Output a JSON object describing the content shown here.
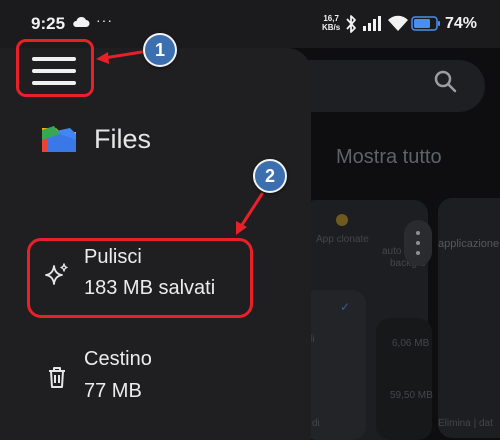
{
  "status_bar": {
    "time": "9:25",
    "dots": "···",
    "net_speed_value": "16,7",
    "net_speed_unit": "KB/s",
    "battery_percent": "74%",
    "icons": [
      "cloud-icon",
      "bluetooth-icon",
      "signal-icon",
      "wifi-icon",
      "battery-icon"
    ]
  },
  "drawer": {
    "app_title": "Files",
    "items": [
      {
        "label": "Pulisci",
        "detail": "183 MB salvati",
        "icon": "sparkle-icon"
      },
      {
        "label": "Cestino",
        "detail": "77 MB",
        "icon": "trash-icon"
      }
    ]
  },
  "background": {
    "show_all": "Mostra tutto",
    "card_texts": [
      "App clonate",
      "applicazione",
      "auto",
      "backgro",
      "li",
      "6,06 MB",
      "59,50 MB",
      "Elimina | dat",
      "di"
    ]
  },
  "annotations": {
    "badge_1": "1",
    "badge_2": "2",
    "color": "#e8202a",
    "badge_color": "#3b6fb0"
  }
}
